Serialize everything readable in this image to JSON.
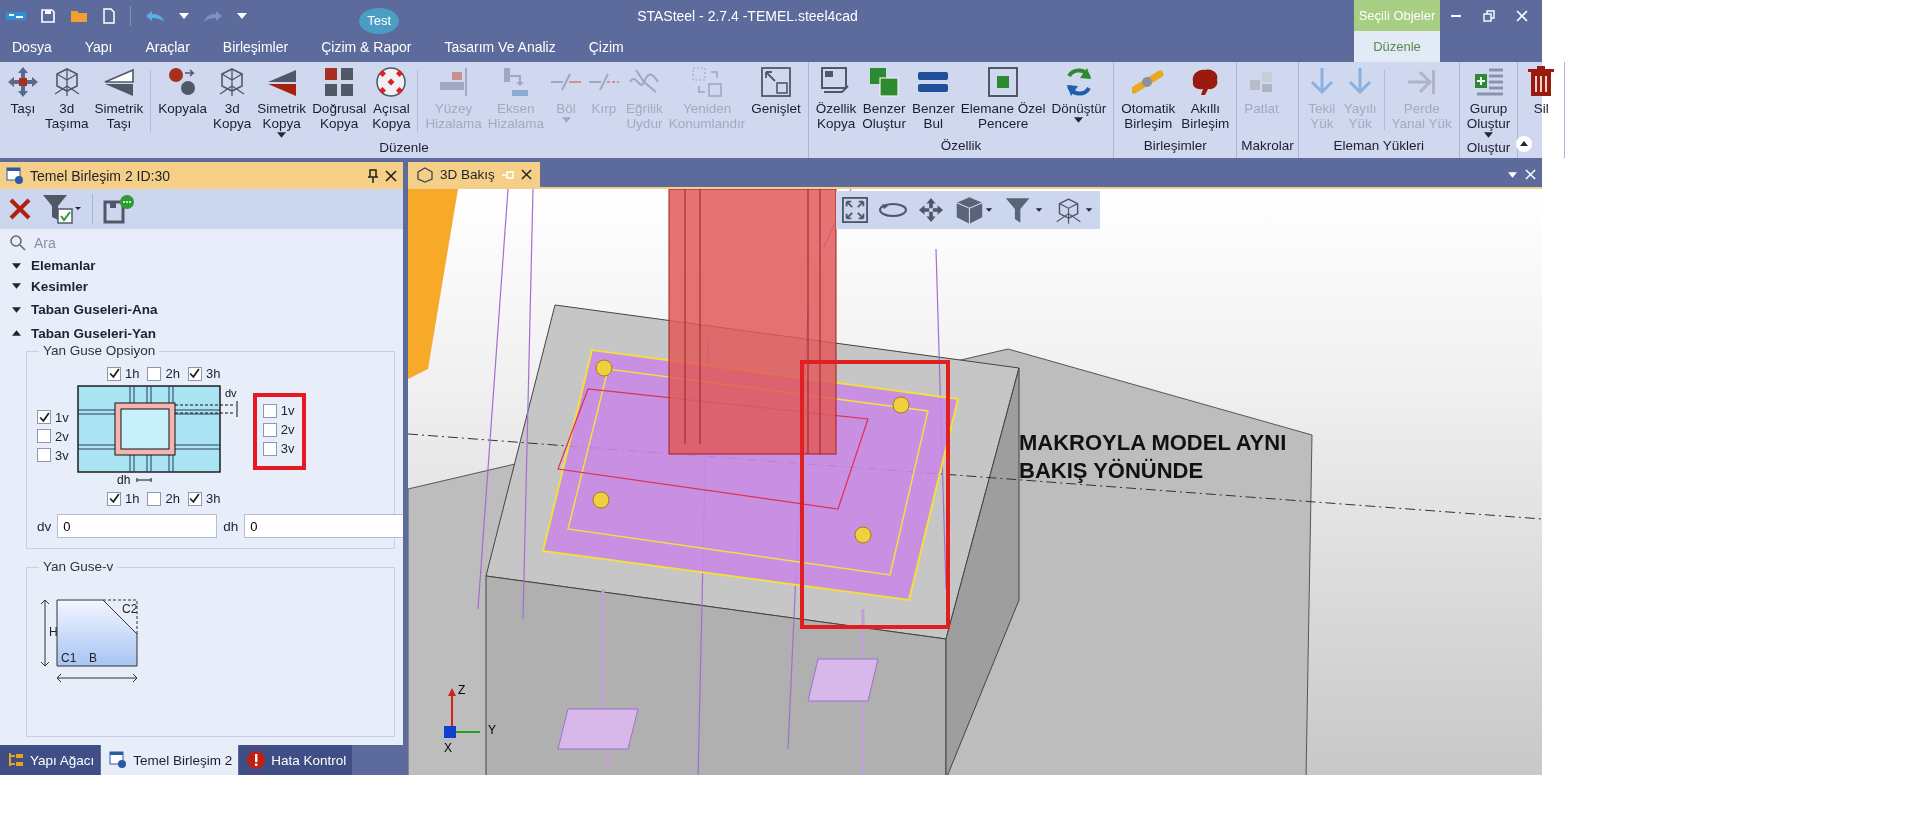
{
  "title_bar": {
    "title": "STASteel - 2.7.4 -TEMEL.steel4cad",
    "context_group": "Seçili Objeler"
  },
  "menu": [
    {
      "label": "Dosya",
      "selected": false
    },
    {
      "label": "Yapı",
      "selected": false
    },
    {
      "label": "Araçlar",
      "selected": false
    },
    {
      "label": "Birleşimler",
      "selected": false
    },
    {
      "label": "Çizim & Rapor",
      "selected": false,
      "badge": "Test"
    },
    {
      "label": "Tasarım Ve Analiz",
      "selected": false
    },
    {
      "label": "Çizim",
      "selected": false
    },
    {
      "label": "Düzenle",
      "selected": true,
      "kind": "context"
    }
  ],
  "ribbon": {
    "groups": [
      {
        "label": "Düzenle",
        "sections": [
          [
            {
              "label": "Taşı",
              "disabled": false,
              "dropdown": false
            },
            {
              "label": "3d\nTaşıma",
              "disabled": false,
              "dropdown": false
            },
            {
              "label": "Simetrik\nTaşı",
              "disabled": false,
              "dropdown": false
            }
          ],
          [
            {
              "label": "Kopyala",
              "disabled": false,
              "dropdown": false
            },
            {
              "label": "3d\nKopya",
              "disabled": false,
              "dropdown": false
            },
            {
              "label": "Simetrik\nKopya",
              "disabled": false,
              "dropdown": true
            },
            {
              "label": "Doğrusal\nKopya",
              "disabled": false,
              "dropdown": false
            },
            {
              "label": "Açısal\nKopya",
              "disabled": false,
              "dropdown": false
            }
          ],
          [
            {
              "label": "Yüzey\nHizalama",
              "disabled": true,
              "dropdown": false
            },
            {
              "label": "Eksen\nHizalama",
              "disabled": true,
              "dropdown": false
            },
            {
              "label": "Böl",
              "disabled": true,
              "dropdown": true
            },
            {
              "label": "Kırp",
              "disabled": true,
              "dropdown": false
            },
            {
              "label": "Eğrilik\nUydur",
              "disabled": true,
              "dropdown": false
            },
            {
              "label": "Yeniden\nKonumlandır",
              "disabled": true,
              "dropdown": false
            },
            {
              "label": "Genişlet",
              "disabled": false,
              "dropdown": false
            }
          ]
        ]
      },
      {
        "label": "Özellik",
        "sections": [
          [
            {
              "label": "Özellik\nKopya",
              "disabled": false,
              "dropdown": false
            },
            {
              "label": "Benzer\nOluştur",
              "disabled": false,
              "dropdown": false
            },
            {
              "label": "Benzer\nBul",
              "disabled": false,
              "dropdown": false
            },
            {
              "label": "Elemane Özel\nPencere",
              "disabled": false,
              "dropdown": false
            },
            {
              "label": "Dönüştür",
              "disabled": false,
              "dropdown": true
            }
          ]
        ]
      },
      {
        "label": "Birleşimler",
        "sections": [
          [
            {
              "label": "Otomatik\nBirleşim",
              "disabled": false,
              "dropdown": false
            },
            {
              "label": "Akıllı\nBirleşim",
              "disabled": false,
              "dropdown": false
            }
          ]
        ]
      },
      {
        "label": "Makrolar",
        "sections": [
          [
            {
              "label": "Patlat",
              "disabled": true,
              "dropdown": false
            }
          ]
        ]
      },
      {
        "label": "Eleman Yükleri",
        "sections": [
          [
            {
              "label": "Tekil\nYük",
              "disabled": true,
              "dropdown": false
            },
            {
              "label": "Yayılı\nYük",
              "disabled": true,
              "dropdown": false
            }
          ],
          [
            {
              "label": "Perde\nYanal Yük",
              "disabled": true,
              "dropdown": false
            }
          ]
        ]
      },
      {
        "label": "Oluştur",
        "sections": [
          [
            {
              "label": "Gurup\nOluştur",
              "disabled": false,
              "dropdown": true
            }
          ]
        ]
      },
      {
        "sections": [
          [
            {
              "label": "Sil",
              "disabled": false,
              "dropdown": false
            }
          ]
        ]
      }
    ]
  },
  "panel": {
    "title": "Temel Birleşim 2 ID:30",
    "search_placeholder": "Ara",
    "sections": [
      {
        "label": "Elemanlar",
        "expanded": false
      },
      {
        "label": "Kesimler",
        "expanded": false
      },
      {
        "label": "Taban Guseleri-Ana",
        "expanded": false
      },
      {
        "label": "Taban Guseleri-Yan",
        "expanded": true
      }
    ],
    "option_group": {
      "title": "Yan Guse Opsiyon",
      "top_checks": [
        {
          "label": "1h",
          "checked": true
        },
        {
          "label": "2h",
          "checked": false
        },
        {
          "label": "3h",
          "checked": true
        }
      ],
      "left_checks": [
        {
          "label": "1v",
          "checked": true
        },
        {
          "label": "2v",
          "checked": false
        },
        {
          "label": "3v",
          "checked": false
        }
      ],
      "right_checks": [
        {
          "label": "1v",
          "checked": false
        },
        {
          "label": "2v",
          "checked": false
        },
        {
          "label": "3v",
          "checked": false
        }
      ],
      "bottom_checks": [
        {
          "label": "1h",
          "checked": true
        },
        {
          "label": "2h",
          "checked": false
        },
        {
          "label": "3h",
          "checked": true
        }
      ],
      "diagram_labels": [
        "dv",
        "dh"
      ],
      "fields": [
        {
          "label": "dv",
          "value": "0"
        },
        {
          "label": "dh",
          "value": "0"
        }
      ]
    },
    "gusset_group": {
      "title": "Yan Guse-v",
      "diagram_labels": [
        "C2",
        "H",
        "C1",
        "B"
      ]
    }
  },
  "bottom_tabs": [
    {
      "label": "Yapı Ağacı",
      "selected": false
    },
    {
      "label": "Temel Birleşim 2",
      "selected": true
    },
    {
      "label": "Hata Kontrol",
      "selected": false
    }
  ],
  "viewport": {
    "tab": {
      "label": "3D Bakış",
      "selected": true
    },
    "annotation": "MAKROYLA MODEL AYNI BAKIŞ YÖNÜNDE",
    "axis_labels": [
      "Z",
      "Y",
      "X"
    ]
  }
}
